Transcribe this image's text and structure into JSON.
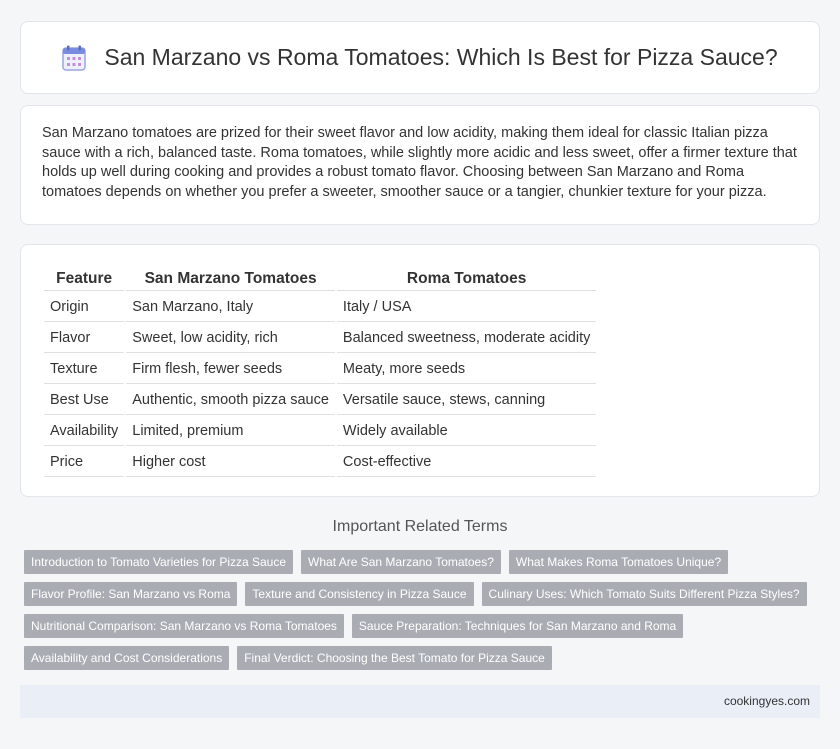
{
  "header": {
    "title": "San Marzano vs Roma Tomatoes: Which Is Best for Pizza Sauce?",
    "icon": "calendar-icon"
  },
  "intro": {
    "text": "San Marzano tomatoes are prized for their sweet flavor and low acidity, making them ideal for classic Italian pizza sauce with a rich, balanced taste. Roma tomatoes, while slightly more acidic and less sweet, offer a firmer texture that holds up well during cooking and provides a robust tomato flavor. Choosing between San Marzano and Roma tomatoes depends on whether you prefer a sweeter, smoother sauce or a tangier, chunkier texture for your pizza."
  },
  "table": {
    "headers": [
      "Feature",
      "San Marzano Tomatoes",
      "Roma Tomatoes"
    ],
    "rows": [
      [
        "Origin",
        "San Marzano, Italy",
        "Italy / USA"
      ],
      [
        "Flavor",
        "Sweet, low acidity, rich",
        "Balanced sweetness, moderate acidity"
      ],
      [
        "Texture",
        "Firm flesh, fewer seeds",
        "Meaty, more seeds"
      ],
      [
        "Best Use",
        "Authentic, smooth pizza sauce",
        "Versatile sauce, stews, canning"
      ],
      [
        "Availability",
        "Limited, premium",
        "Widely available"
      ],
      [
        "Price",
        "Higher cost",
        "Cost-effective"
      ]
    ]
  },
  "related": {
    "title": "Important Related Terms",
    "rows": [
      [
        "Introduction to Tomato Varieties for Pizza Sauce",
        "What Are San Marzano Tomatoes?",
        "What Makes Roma Tomatoes Unique?"
      ],
      [
        "Flavor Profile: San Marzano vs Roma",
        "Texture and Consistency in Pizza Sauce",
        "Culinary Uses: Which Tomato Suits Different Pizza Styles?"
      ],
      [
        "Nutritional Comparison: San Marzano vs Roma Tomatoes",
        "Sauce Preparation: Techniques for San Marzano and Roma"
      ],
      [
        "Availability and Cost Considerations",
        "Final Verdict: Choosing the Best Tomato for Pizza Sauce"
      ]
    ]
  },
  "footer": {
    "site": "cookingyes.com"
  },
  "colors": {
    "tag_bg": "#a9adb3",
    "footer_bg": "#e9eef7",
    "icon_accent": "#7b8cde"
  }
}
